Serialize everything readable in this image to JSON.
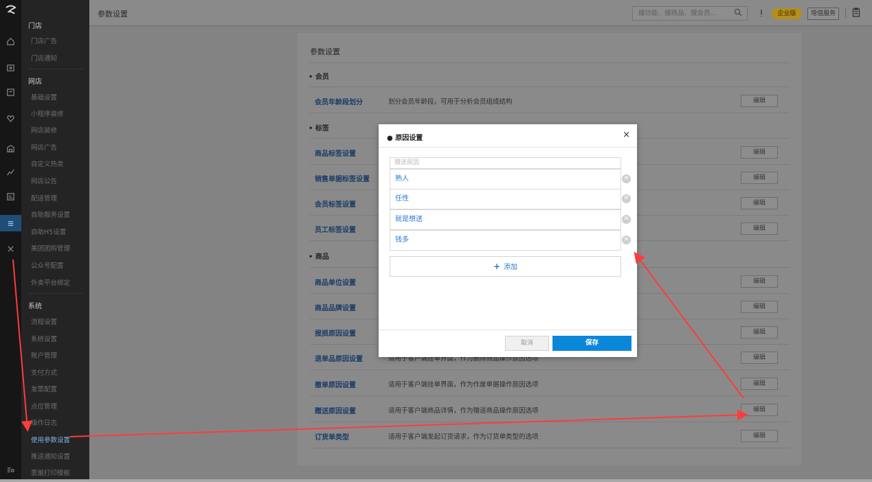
{
  "topbar": {
    "title": "参数设置",
    "search_placeholder": "搜功能、搜商品、搜会员...",
    "edition_badge": "企业版",
    "value_added_label": "增值服务"
  },
  "sidebar": {
    "groups": [
      {
        "label": "门店"
      },
      {
        "label": "网店"
      },
      {
        "label": "系统"
      }
    ],
    "items": [
      "门店广告",
      "门店通知",
      "基础设置",
      "小程序装修",
      "网店装修",
      "网店广告",
      "自定义热卖",
      "网店公告",
      "配送管理",
      "自助服务设置",
      "自助H5设置",
      "美团团购管理",
      "公众号配置",
      "外卖平台绑定",
      "流程设置",
      "系统设置",
      "账户管理",
      "支付方式",
      "发票配置",
      "点位管理",
      "操作日志",
      "使用参数设置",
      "推送通知设置",
      "票据打印模板"
    ]
  },
  "panel": {
    "title": "参数设置",
    "sections": [
      "会员",
      "标签",
      "商品"
    ],
    "edit_label": "编辑",
    "rows": [
      {
        "name": "会员年龄段划分",
        "desc": "划分会员年龄段，可用于分析会员组成结构"
      },
      {
        "name": "商品标签设置",
        "desc": ""
      },
      {
        "name": "销售单据标签设置",
        "desc": ""
      },
      {
        "name": "会员标签设置",
        "desc": ""
      },
      {
        "name": "员工标签设置",
        "desc": ""
      },
      {
        "name": "商品单位设置",
        "desc": ""
      },
      {
        "name": "商品品牌设置",
        "desc": ""
      },
      {
        "name": "报损原因设置",
        "desc": ""
      },
      {
        "name": "退单品原因设置",
        "desc": "适用于客户端挂单界面，作为删除商品操作原因选项"
      },
      {
        "name": "撤单原因设置",
        "desc": "适用于客户端挂单界面，作为作废单据操作原因选项"
      },
      {
        "name": "赠送原因设置",
        "desc": "适用于客户端商品详情，作为赠送商品操作原因选项"
      },
      {
        "name": "订货单类型",
        "desc": "适用于客户端发起订货请求，作为订货单类型的选项"
      }
    ]
  },
  "dialog": {
    "title": "原因设置",
    "close_glyph": "×",
    "header_placeholder": "赠送原因",
    "reasons": [
      "熟人",
      "任性",
      "就是想送",
      "钱多"
    ],
    "add_label": "添加",
    "cancel_label": "取消",
    "save_label": "保存"
  },
  "colors": {
    "accent": "#0b87da",
    "link": "#2a7ad0",
    "annotation_arrow": "#ff3b3b"
  }
}
